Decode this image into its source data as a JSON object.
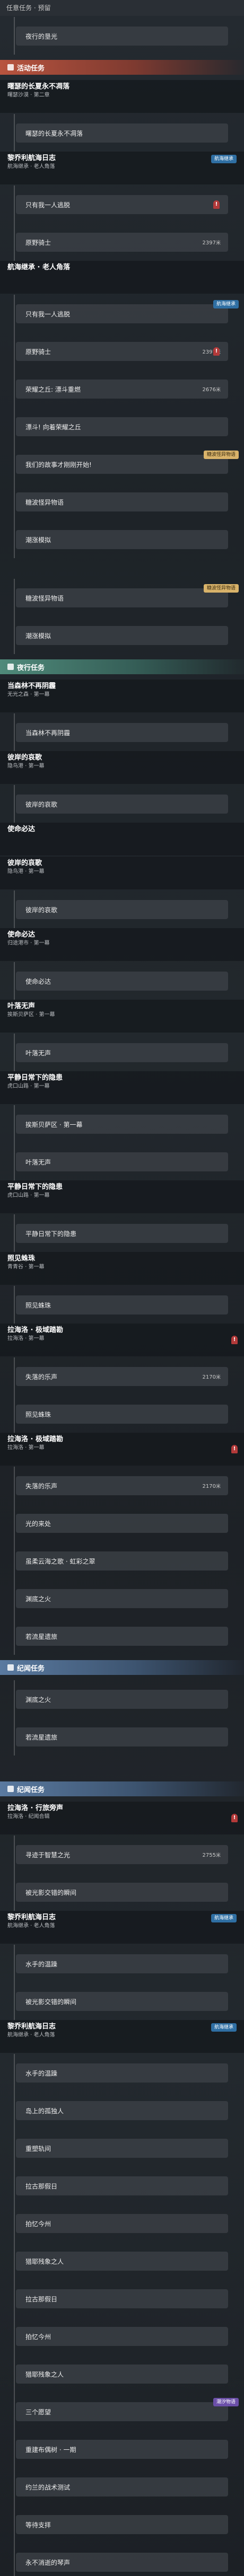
{
  "header": {
    "title": "任意任务 · 预留"
  },
  "sections": [
    {
      "type": "item",
      "label": "夜行的垦光"
    },
    {
      "type": "section",
      "style": "event",
      "label": "活动任务"
    },
    {
      "type": "quest",
      "title": "曙瑟的长夏永不凋落",
      "sub": "曙瑟沙漠 · 第二章"
    },
    {
      "type": "item",
      "label": "曙瑟的长夏永不凋落"
    },
    {
      "type": "quest",
      "title": "黎乔利航海日志",
      "sub": "航海继承 · 老人角落",
      "badge": "航海继承",
      "badge_color": "blue"
    },
    {
      "type": "item",
      "label": "只有我一人逃脱",
      "alert": true
    },
    {
      "type": "item",
      "label": "原野骑士",
      "distance": "2397",
      "unit": "米"
    },
    {
      "type": "quest",
      "title": "航海继承 · 老人角落",
      "sub": ""
    },
    {
      "type": "item",
      "label": "只有我一人逃脱",
      "badge": "航海继承",
      "badge_color": "blue"
    },
    {
      "type": "item",
      "label": "原野骑士",
      "distance": "2397",
      "unit": "米",
      "alert": true
    },
    {
      "type": "item",
      "label": "荣耀之丘: 漂斗重燃",
      "distance": "2676",
      "unit": "米"
    },
    {
      "type": "item",
      "label": "漂斗! 向着荣耀之丘"
    },
    {
      "type": "item",
      "label": "我们的故事才刚刚开始!",
      "badge": "糖波怪异物语",
      "badge_color": "gold"
    },
    {
      "type": "item",
      "label": "糖波怪异物语"
    },
    {
      "type": "item",
      "label": "潮涨模拟"
    },
    {
      "type": "spacer"
    },
    {
      "type": "item",
      "label": "糖波怪异物语",
      "badge": "糖波怪异物语",
      "badge_color": "gold"
    },
    {
      "type": "item",
      "label": "潮涨模拟"
    },
    {
      "type": "section",
      "style": "daily",
      "label": "夜行任务"
    },
    {
      "type": "quest",
      "title": "当森林不再阴霾",
      "sub": "无光之森 · 第一幕"
    },
    {
      "type": "item",
      "label": "当森林不再阴霾"
    },
    {
      "type": "quest",
      "title": "彼岸的哀歌",
      "sub": "隐鸟港 · 第一幕"
    },
    {
      "type": "item",
      "label": "彼岸的哀歌"
    },
    {
      "type": "quest",
      "title": "使命必达",
      "sub": ""
    },
    {
      "type": "quest",
      "title": "彼岸的哀歌",
      "sub": "隐鸟港 · 第一幕"
    },
    {
      "type": "item",
      "label": "彼岸的哀歌"
    },
    {
      "type": "quest",
      "title": "使命必达",
      "sub": "归途港市 · 第一幕"
    },
    {
      "type": "item",
      "label": "使命必达"
    },
    {
      "type": "quest",
      "title": "叶落无声",
      "sub": "挨斯贝萨区 · 第一幕"
    },
    {
      "type": "item",
      "label": "叶落无声"
    },
    {
      "type": "quest",
      "title": "平静日常下的隐患",
      "sub": "虎口山路 · 第一幕"
    },
    {
      "type": "item",
      "label": "挨斯贝萨区 · 第一幕"
    },
    {
      "type": "item",
      "label": "叶落无声"
    },
    {
      "type": "quest",
      "title": "平静日常下的隐患",
      "sub": "虎口山路 · 第一幕"
    },
    {
      "type": "item",
      "label": "平静日常下的隐患"
    },
    {
      "type": "quest",
      "title": "照见蛛珠",
      "sub": "青青谷 · 第一幕"
    },
    {
      "type": "item",
      "label": "照见蛛珠"
    },
    {
      "type": "quest",
      "title": "拉海洛 · 极域踏勘",
      "sub": "拉海洛 · 第一幕",
      "alert": true
    },
    {
      "type": "item",
      "label": "失落的乐声",
      "distance": "2170",
      "unit": "米"
    },
    {
      "type": "item",
      "label": "照见蛛珠"
    },
    {
      "type": "quest",
      "title": "拉海洛 · 极域踏勘",
      "sub": "拉海洛 · 第一幕",
      "alert": true
    },
    {
      "type": "item",
      "label": "失落的乐声",
      "distance": "2170",
      "unit": "米"
    },
    {
      "type": "item",
      "label": "光的来处"
    },
    {
      "type": "item",
      "label": "虽柔云海之歌 · 虹彩之翠"
    },
    {
      "type": "item",
      "label": "渊底之火"
    },
    {
      "type": "item",
      "label": "若流星遗旅"
    },
    {
      "type": "section",
      "style": "memory",
      "label": "纪闻任务"
    },
    {
      "type": "item",
      "label": "渊底之火"
    },
    {
      "type": "item",
      "label": "若流星遗旅"
    },
    {
      "type": "spacer"
    },
    {
      "type": "section",
      "style": "memory",
      "label": "纪闻任务"
    },
    {
      "type": "quest",
      "title": "拉海洛 · 行旅旁声",
      "sub": "拉海洛 · 纪闻合辑",
      "alert": true
    },
    {
      "type": "item",
      "label": "寻迹于智慧之光",
      "distance": "2755",
      "unit": "米"
    },
    {
      "type": "item",
      "label": "被光影交错的瞬间"
    },
    {
      "type": "quest",
      "title": "黎乔利航海日志",
      "sub": "航海继承 · 老人角落",
      "badge": "航海继承",
      "badge_color": "blue"
    },
    {
      "type": "item",
      "label": "水手的温躁"
    },
    {
      "type": "item",
      "label": "被光影交错的瞬间"
    },
    {
      "type": "quest",
      "title": "黎乔利航海日志",
      "sub": "航海继承 · 老人角落",
      "badge": "航海继承",
      "badge_color": "blue"
    },
    {
      "type": "item",
      "label": "水手的温躁"
    },
    {
      "type": "item",
      "label": "岛上的孤独人"
    },
    {
      "type": "item",
      "label": "重塑轨间"
    },
    {
      "type": "item",
      "label": "拉古那假日"
    },
    {
      "type": "item",
      "label": "拍忆今州"
    },
    {
      "type": "item",
      "label": "猎耶残象之人"
    },
    {
      "type": "item",
      "label": "拉古那假日"
    },
    {
      "type": "item",
      "label": "拍忆今州"
    },
    {
      "type": "item",
      "label": "猎耶残象之人"
    },
    {
      "type": "item",
      "label": "三个愿望",
      "badge": "潮汐物语",
      "badge_color": "purple"
    },
    {
      "type": "item",
      "label": "重建布偶树 · 一期"
    },
    {
      "type": "item",
      "label": "约兰的战术测试"
    },
    {
      "type": "item",
      "label": "等待支拝"
    },
    {
      "type": "item",
      "label": "永不消逝的琴声"
    }
  ]
}
